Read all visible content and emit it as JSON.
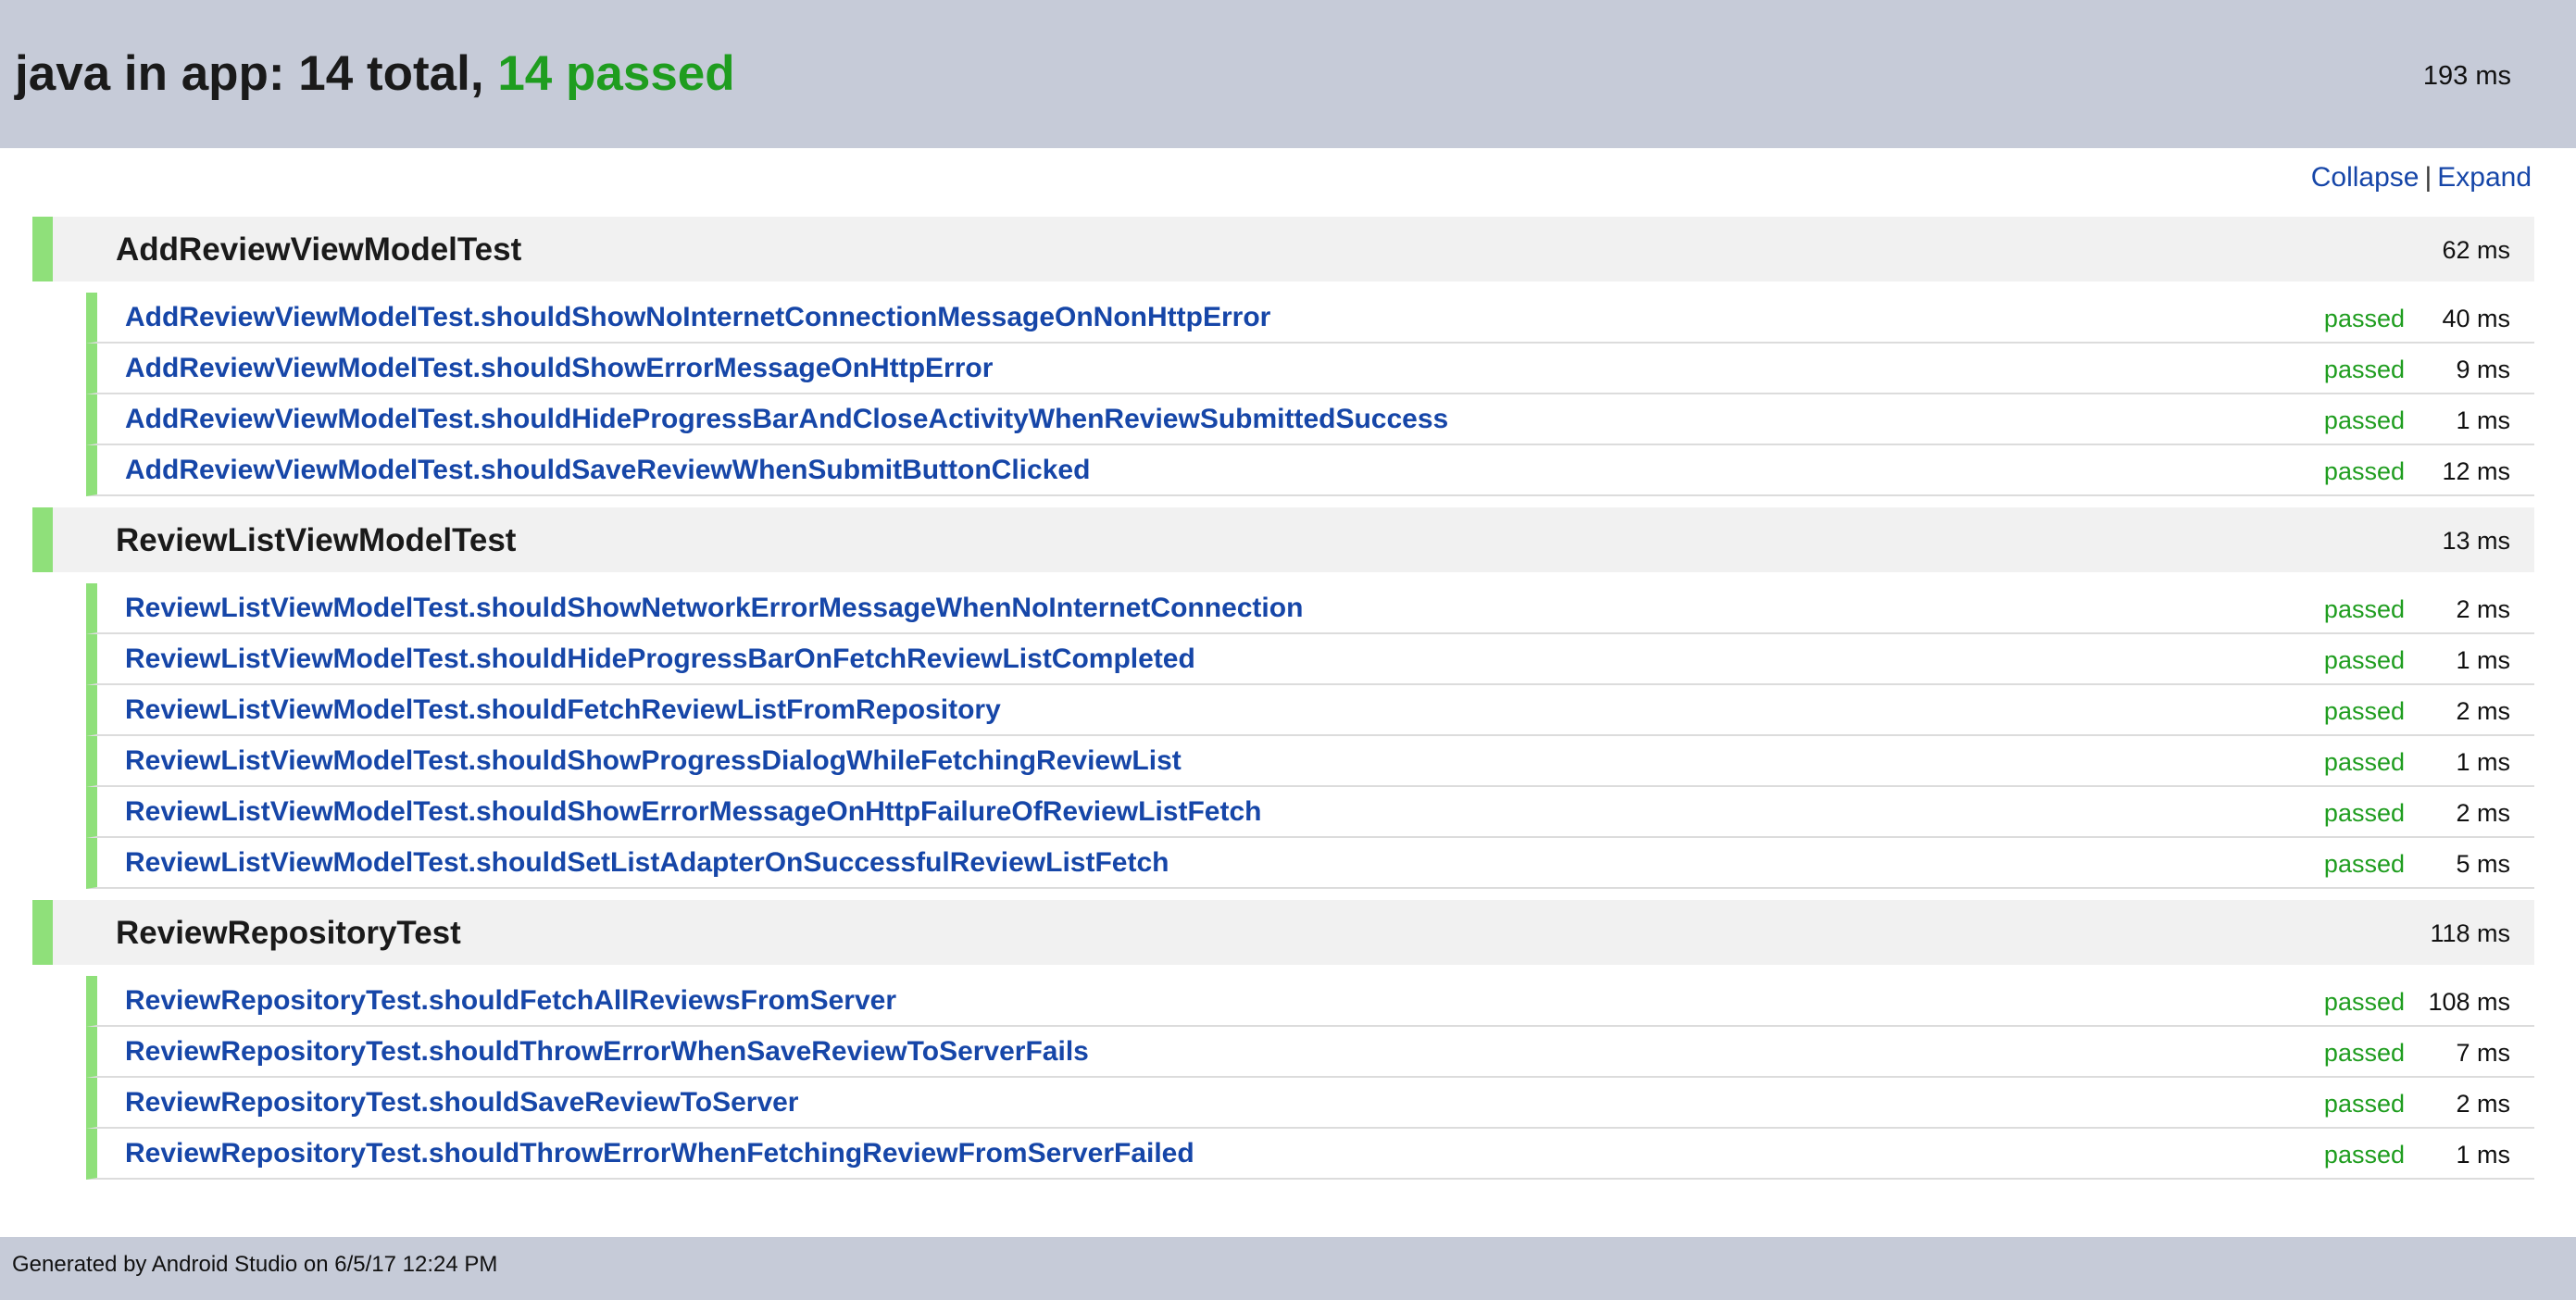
{
  "header": {
    "title_prefix": "java in app: 14 total, ",
    "title_passed": "14 passed",
    "duration": "193 ms"
  },
  "controls": {
    "collapse_label": "Collapse",
    "separator": "|",
    "expand_label": "Expand"
  },
  "groups": [
    {
      "name": "AddReviewViewModelTest",
      "duration": "62 ms",
      "tests": [
        {
          "name": "AddReviewViewModelTest.shouldShowNoInternetConnectionMessageOnNonHttpError",
          "status": "passed",
          "duration": "40 ms"
        },
        {
          "name": "AddReviewViewModelTest.shouldShowErrorMessageOnHttpError",
          "status": "passed",
          "duration": "9 ms"
        },
        {
          "name": "AddReviewViewModelTest.shouldHideProgressBarAndCloseActivityWhenReviewSubmittedSuccess",
          "status": "passed",
          "duration": "1 ms"
        },
        {
          "name": "AddReviewViewModelTest.shouldSaveReviewWhenSubmitButtonClicked",
          "status": "passed",
          "duration": "12 ms"
        }
      ]
    },
    {
      "name": "ReviewListViewModelTest",
      "duration": "13 ms",
      "tests": [
        {
          "name": "ReviewListViewModelTest.shouldShowNetworkErrorMessageWhenNoInternetConnection",
          "status": "passed",
          "duration": "2 ms"
        },
        {
          "name": "ReviewListViewModelTest.shouldHideProgressBarOnFetchReviewListCompleted",
          "status": "passed",
          "duration": "1 ms"
        },
        {
          "name": "ReviewListViewModelTest.shouldFetchReviewListFromRepository",
          "status": "passed",
          "duration": "2 ms"
        },
        {
          "name": "ReviewListViewModelTest.shouldShowProgressDialogWhileFetchingReviewList",
          "status": "passed",
          "duration": "1 ms"
        },
        {
          "name": "ReviewListViewModelTest.shouldShowErrorMessageOnHttpFailureOfReviewListFetch",
          "status": "passed",
          "duration": "2 ms"
        },
        {
          "name": "ReviewListViewModelTest.shouldSetListAdapterOnSuccessfulReviewListFetch",
          "status": "passed",
          "duration": "5 ms"
        }
      ]
    },
    {
      "name": "ReviewRepositoryTest",
      "duration": "118 ms",
      "tests": [
        {
          "name": "ReviewRepositoryTest.shouldFetchAllReviewsFromServer",
          "status": "passed",
          "duration": "108 ms"
        },
        {
          "name": "ReviewRepositoryTest.shouldThrowErrorWhenSaveReviewToServerFails",
          "status": "passed",
          "duration": "7 ms"
        },
        {
          "name": "ReviewRepositoryTest.shouldSaveReviewToServer",
          "status": "passed",
          "duration": "2 ms"
        },
        {
          "name": "ReviewRepositoryTest.shouldThrowErrorWhenFetchingReviewFromServerFailed",
          "status": "passed",
          "duration": "1 ms"
        }
      ]
    }
  ],
  "footer": {
    "text": "Generated by Android Studio on 6/5/17 12:24 PM"
  },
  "colors": {
    "header_bg": "#c6cbd8",
    "pass_green": "#1f9d1f",
    "status_bar_green": "#8fe07a",
    "link_blue": "#1646a8",
    "group_bg": "#f1f1f1"
  }
}
